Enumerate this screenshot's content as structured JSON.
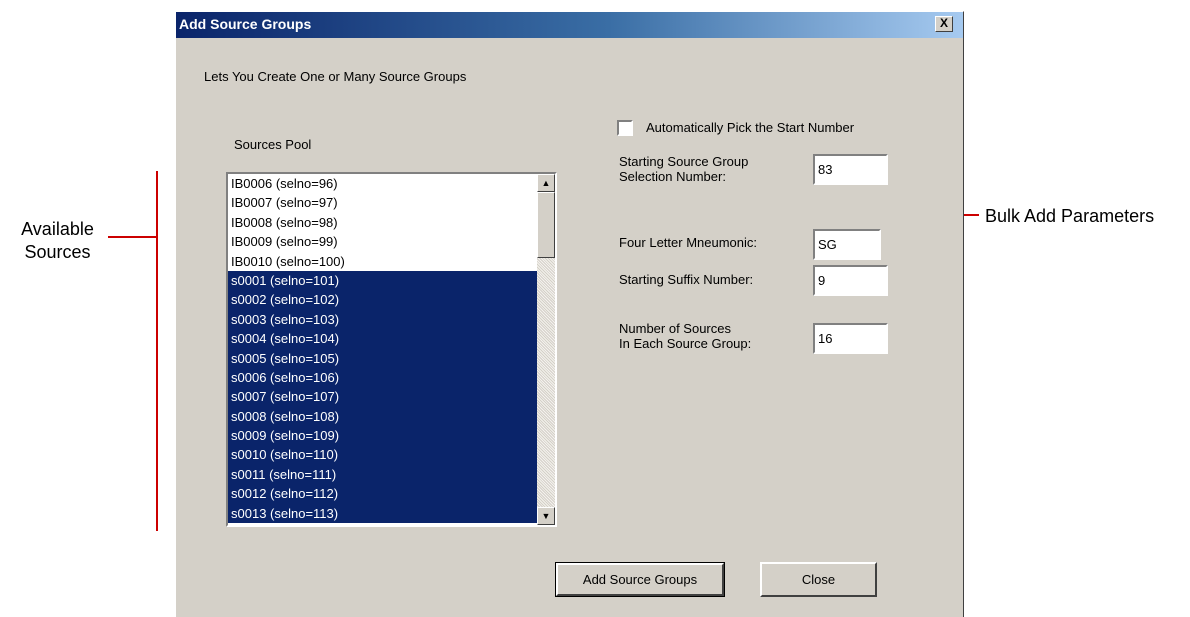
{
  "window": {
    "title": "Add Source Groups",
    "close_label": "X"
  },
  "description": "Lets You Create One or Many Source Groups",
  "sources_pool": {
    "label": "Sources Pool",
    "items": [
      {
        "label": "IB0006 (selno=96)",
        "selected": false
      },
      {
        "label": "IB0007 (selno=97)",
        "selected": false
      },
      {
        "label": "IB0008 (selno=98)",
        "selected": false
      },
      {
        "label": "IB0009 (selno=99)",
        "selected": false
      },
      {
        "label": "IB0010 (selno=100)",
        "selected": false
      },
      {
        "label": "s0001 (selno=101)",
        "selected": true
      },
      {
        "label": "s0002 (selno=102)",
        "selected": true
      },
      {
        "label": "s0003 (selno=103)",
        "selected": true
      },
      {
        "label": "s0004 (selno=104)",
        "selected": true
      },
      {
        "label": "s0005 (selno=105)",
        "selected": true
      },
      {
        "label": "s0006 (selno=106)",
        "selected": true
      },
      {
        "label": "s0007 (selno=107)",
        "selected": true
      },
      {
        "label": "s0008 (selno=108)",
        "selected": true
      },
      {
        "label": "s0009 (selno=109)",
        "selected": true
      },
      {
        "label": "s0010 (selno=110)",
        "selected": true
      },
      {
        "label": "s0011 (selno=111)",
        "selected": true
      },
      {
        "label": "s0012 (selno=112)",
        "selected": true
      },
      {
        "label": "s0013 (selno=113)",
        "selected": true
      }
    ],
    "scroll_up_icon": "triangle-up",
    "scroll_down_icon": "triangle-down"
  },
  "parameters": {
    "auto_pick": {
      "label": "Automatically Pick the Start Number",
      "checked": false
    },
    "starting_selection": {
      "label": "Starting Source Group\nSelection Number:",
      "value": "83"
    },
    "mnemonic": {
      "label": "Four Letter Mneumonic:",
      "value": "SG"
    },
    "suffix": {
      "label": "Starting Suffix Number:",
      "value": "9"
    },
    "sources_per_group": {
      "label": "Number of Sources\nIn Each Source Group:",
      "value": "16"
    }
  },
  "buttons": {
    "add": "Add Source Groups",
    "close": "Close"
  },
  "annotations": {
    "available": "Available\nSources",
    "bulk": "Bulk Add Parameters",
    "callout_color": "#cc0000"
  }
}
